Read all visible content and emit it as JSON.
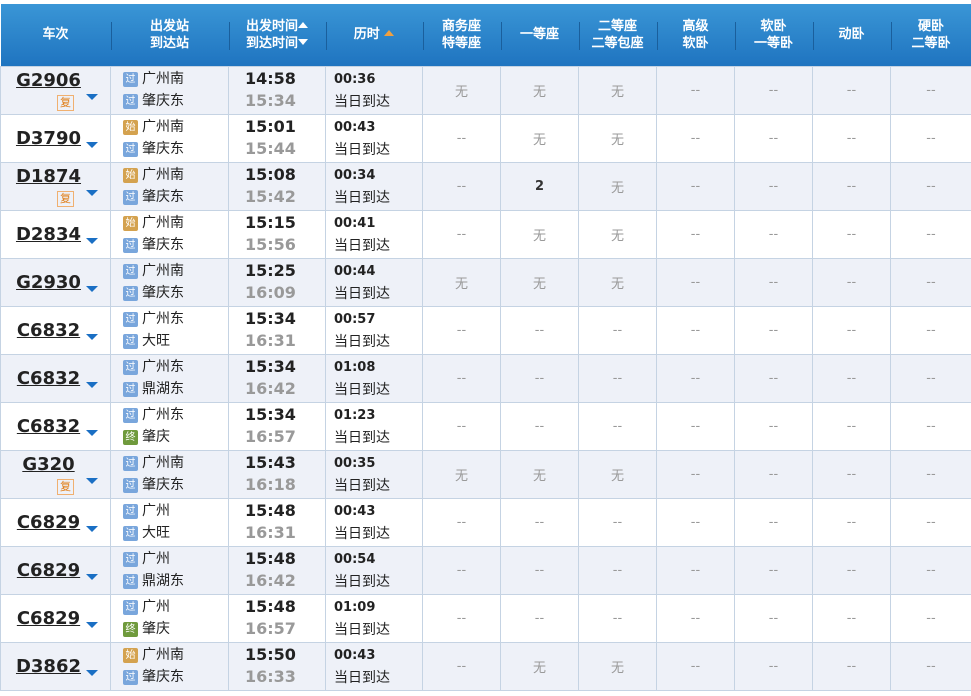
{
  "headers": {
    "train": "车次",
    "stations": [
      "出发站",
      "到达站"
    ],
    "times": [
      "出发时间",
      "到达时间"
    ],
    "duration": "历时",
    "seats": [
      [
        "商务座",
        "特等座"
      ],
      [
        "一等座"
      ],
      [
        "二等座",
        "二等包座"
      ],
      [
        "高级",
        "软卧"
      ],
      [
        "软卧",
        "一等卧"
      ],
      [
        "动卧"
      ],
      [
        "硬卧",
        "二等卧"
      ]
    ]
  },
  "badges": {
    "guo": "过",
    "shi": "始",
    "zhong": "终",
    "fu": "复"
  },
  "rows": [
    {
      "no": "G2906",
      "fu": true,
      "from": "广州南",
      "fb": "guo",
      "to": "肇庆东",
      "tb": "guo",
      "dep": "14:58",
      "arr": "15:34",
      "dur": "00:36",
      "day": "当日到达",
      "seats": [
        "无",
        "无",
        "无",
        "--",
        "--",
        "--",
        "--"
      ]
    },
    {
      "no": "D3790",
      "fu": false,
      "from": "广州南",
      "fb": "shi",
      "to": "肇庆东",
      "tb": "guo",
      "dep": "15:01",
      "arr": "15:44",
      "dur": "00:43",
      "day": "当日到达",
      "seats": [
        "--",
        "无",
        "无",
        "--",
        "--",
        "--",
        "--"
      ]
    },
    {
      "no": "D1874",
      "fu": true,
      "from": "广州南",
      "fb": "shi",
      "to": "肇庆东",
      "tb": "guo",
      "dep": "15:08",
      "arr": "15:42",
      "dur": "00:34",
      "day": "当日到达",
      "seats": [
        "--",
        "2",
        "无",
        "--",
        "--",
        "--",
        "--"
      ]
    },
    {
      "no": "D2834",
      "fu": false,
      "from": "广州南",
      "fb": "shi",
      "to": "肇庆东",
      "tb": "guo",
      "dep": "15:15",
      "arr": "15:56",
      "dur": "00:41",
      "day": "当日到达",
      "seats": [
        "--",
        "无",
        "无",
        "--",
        "--",
        "--",
        "--"
      ]
    },
    {
      "no": "G2930",
      "fu": false,
      "from": "广州南",
      "fb": "guo",
      "to": "肇庆东",
      "tb": "guo",
      "dep": "15:25",
      "arr": "16:09",
      "dur": "00:44",
      "day": "当日到达",
      "seats": [
        "无",
        "无",
        "无",
        "--",
        "--",
        "--",
        "--"
      ]
    },
    {
      "no": "C6832",
      "fu": false,
      "from": "广州东",
      "fb": "guo",
      "to": "大旺",
      "tb": "guo",
      "dep": "15:34",
      "arr": "16:31",
      "dur": "00:57",
      "day": "当日到达",
      "seats": [
        "--",
        "--",
        "--",
        "--",
        "--",
        "--",
        "--"
      ]
    },
    {
      "no": "C6832",
      "fu": false,
      "from": "广州东",
      "fb": "guo",
      "to": "鼎湖东",
      "tb": "guo",
      "dep": "15:34",
      "arr": "16:42",
      "dur": "01:08",
      "day": "当日到达",
      "seats": [
        "--",
        "--",
        "--",
        "--",
        "--",
        "--",
        "--"
      ]
    },
    {
      "no": "C6832",
      "fu": false,
      "from": "广州东",
      "fb": "guo",
      "to": "肇庆",
      "tb": "zhong",
      "dep": "15:34",
      "arr": "16:57",
      "dur": "01:23",
      "day": "当日到达",
      "seats": [
        "--",
        "--",
        "--",
        "--",
        "--",
        "--",
        "--"
      ]
    },
    {
      "no": "G320",
      "fu": true,
      "from": "广州南",
      "fb": "guo",
      "to": "肇庆东",
      "tb": "guo",
      "dep": "15:43",
      "arr": "16:18",
      "dur": "00:35",
      "day": "当日到达",
      "seats": [
        "无",
        "无",
        "无",
        "--",
        "--",
        "--",
        "--"
      ]
    },
    {
      "no": "C6829",
      "fu": false,
      "from": "广州",
      "fb": "guo",
      "to": "大旺",
      "tb": "guo",
      "dep": "15:48",
      "arr": "16:31",
      "dur": "00:43",
      "day": "当日到达",
      "seats": [
        "--",
        "--",
        "--",
        "--",
        "--",
        "--",
        "--"
      ]
    },
    {
      "no": "C6829",
      "fu": false,
      "from": "广州",
      "fb": "guo",
      "to": "鼎湖东",
      "tb": "guo",
      "dep": "15:48",
      "arr": "16:42",
      "dur": "00:54",
      "day": "当日到达",
      "seats": [
        "--",
        "--",
        "--",
        "--",
        "--",
        "--",
        "--"
      ]
    },
    {
      "no": "C6829",
      "fu": false,
      "from": "广州",
      "fb": "guo",
      "to": "肇庆",
      "tb": "zhong",
      "dep": "15:48",
      "arr": "16:57",
      "dur": "01:09",
      "day": "当日到达",
      "seats": [
        "--",
        "--",
        "--",
        "--",
        "--",
        "--",
        "--"
      ]
    },
    {
      "no": "D3862",
      "fu": false,
      "from": "广州南",
      "fb": "shi",
      "to": "肇庆东",
      "tb": "guo",
      "dep": "15:50",
      "arr": "16:33",
      "dur": "00:43",
      "day": "当日到达",
      "seats": [
        "--",
        "无",
        "无",
        "--",
        "--",
        "--",
        "--"
      ]
    }
  ]
}
